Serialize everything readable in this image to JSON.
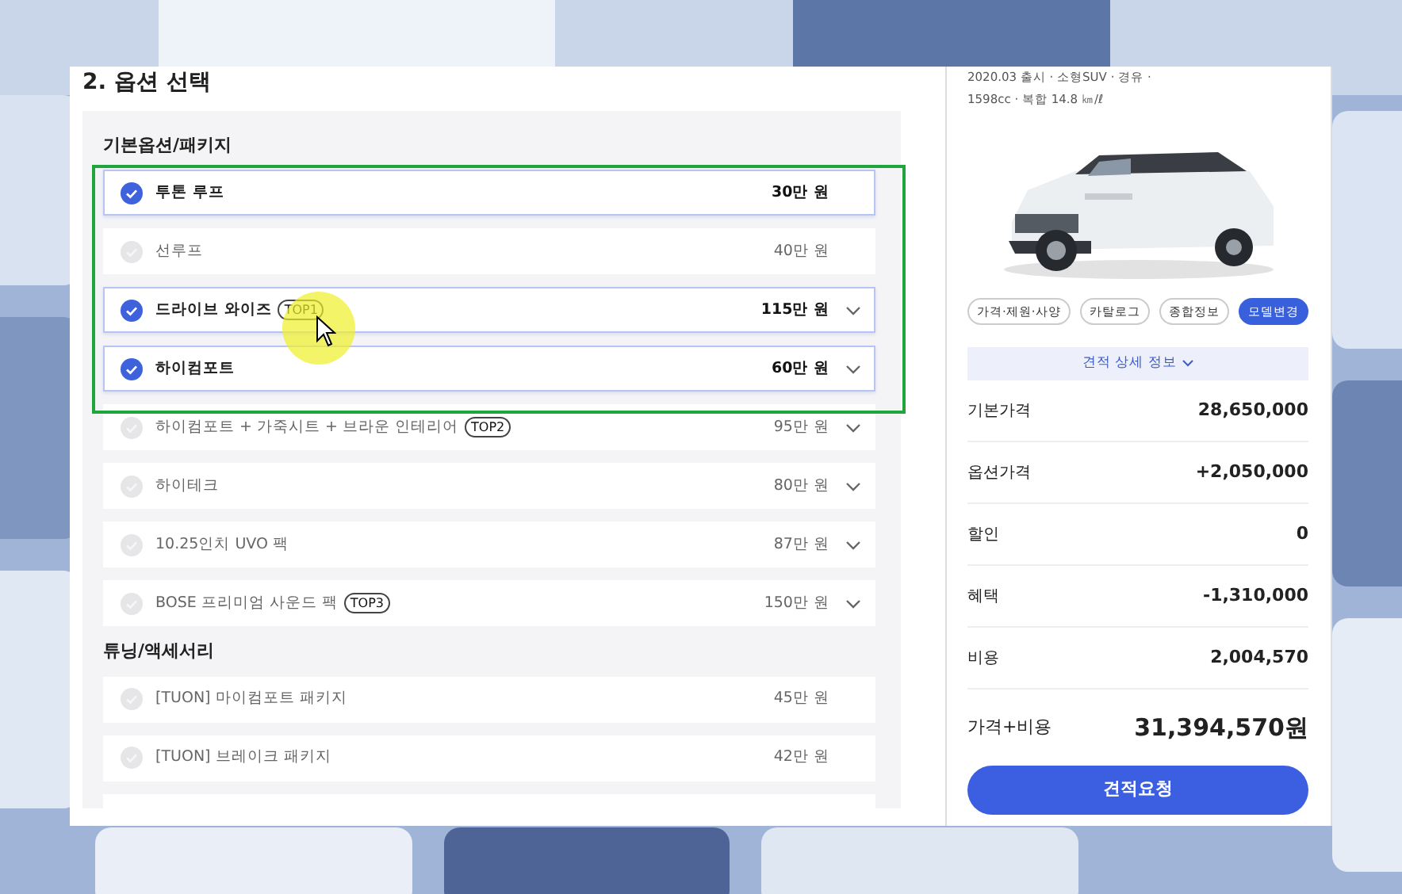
{
  "section_title": "2. 옵션 선택",
  "groups": [
    {
      "title": "기본옵션/패키지",
      "options": [
        {
          "name": "투톤 루프",
          "price": "30만 원",
          "selected": true,
          "expandable": false
        },
        {
          "name": "선루프",
          "price": "40만 원",
          "selected": false,
          "expandable": false
        },
        {
          "name": "드라이브 와이즈",
          "tag": "TOP1",
          "price": "115만 원",
          "selected": true,
          "expandable": true
        },
        {
          "name": "하이컴포트",
          "price": "60만 원",
          "selected": true,
          "expandable": true
        },
        {
          "name": "하이컴포트 + 가죽시트 + 브라운 인테리어",
          "tag": "TOP2",
          "price": "95만 원",
          "selected": false,
          "expandable": true
        },
        {
          "name": "하이테크",
          "price": "80만 원",
          "selected": false,
          "expandable": true
        },
        {
          "name": "10.25인치 UVO 팩",
          "price": "87만 원",
          "selected": false,
          "expandable": true
        },
        {
          "name": "BOSE 프리미엄 사운드 팩",
          "tag": "TOP3",
          "price": "150만 원",
          "selected": false,
          "expandable": true
        }
      ]
    },
    {
      "title": "튜닝/액세서리",
      "options": [
        {
          "name": "[TUON] 마이컴포트 패키지",
          "price": "45만 원",
          "selected": false,
          "expandable": false
        },
        {
          "name": "[TUON] 브레이크 패키지",
          "price": "42만 원",
          "selected": false,
          "expandable": false
        }
      ]
    }
  ],
  "car": {
    "specs": [
      "2020.03 출시 · 소형SUV · 경유 ·",
      "1598cc · 복합 14.8 ㎞/ℓ"
    ]
  },
  "car_tabs": [
    {
      "label": "가격·제원·사양",
      "selected": false
    },
    {
      "label": "카탈로그",
      "selected": false
    },
    {
      "label": "종합정보",
      "selected": false
    },
    {
      "label": "모델변경",
      "selected": true
    }
  ],
  "estimate_toggle": {
    "label": "견적 상세 정보",
    "expanded": false
  },
  "price_rows": [
    {
      "label": "기본가격",
      "value": "28,650,000"
    },
    {
      "label": "옵션가격",
      "value": "+2,050,000"
    },
    {
      "label": "할인",
      "value": "0"
    },
    {
      "label": "혜택",
      "value": "-1,310,000"
    },
    {
      "label": "비용",
      "value": "2,004,570"
    }
  ],
  "total": {
    "label": "가격+비용",
    "value": "31,394,570원"
  },
  "request_button": "견적요청"
}
